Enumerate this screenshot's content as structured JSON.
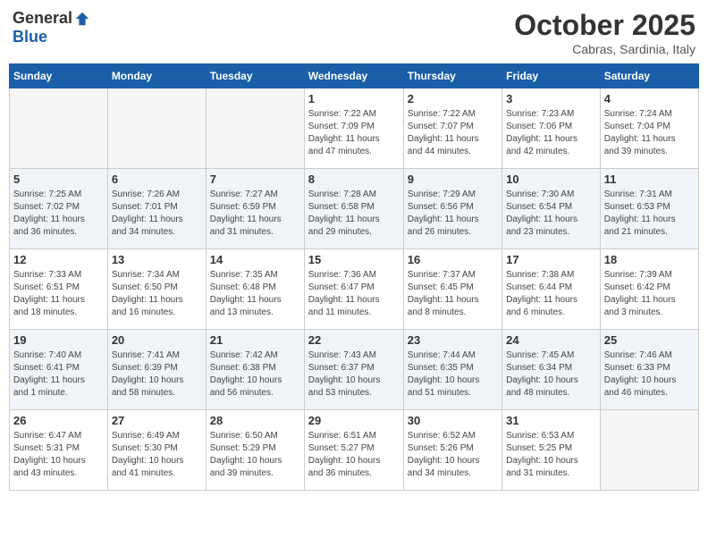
{
  "header": {
    "logo_general": "General",
    "logo_blue": "Blue",
    "month": "October 2025",
    "location": "Cabras, Sardinia, Italy"
  },
  "weekdays": [
    "Sunday",
    "Monday",
    "Tuesday",
    "Wednesday",
    "Thursday",
    "Friday",
    "Saturday"
  ],
  "weeks": [
    [
      {
        "day": "",
        "info": ""
      },
      {
        "day": "",
        "info": ""
      },
      {
        "day": "",
        "info": ""
      },
      {
        "day": "1",
        "info": "Sunrise: 7:22 AM\nSunset: 7:09 PM\nDaylight: 11 hours\nand 47 minutes."
      },
      {
        "day": "2",
        "info": "Sunrise: 7:22 AM\nSunset: 7:07 PM\nDaylight: 11 hours\nand 44 minutes."
      },
      {
        "day": "3",
        "info": "Sunrise: 7:23 AM\nSunset: 7:06 PM\nDaylight: 11 hours\nand 42 minutes."
      },
      {
        "day": "4",
        "info": "Sunrise: 7:24 AM\nSunset: 7:04 PM\nDaylight: 11 hours\nand 39 minutes."
      }
    ],
    [
      {
        "day": "5",
        "info": "Sunrise: 7:25 AM\nSunset: 7:02 PM\nDaylight: 11 hours\nand 36 minutes."
      },
      {
        "day": "6",
        "info": "Sunrise: 7:26 AM\nSunset: 7:01 PM\nDaylight: 11 hours\nand 34 minutes."
      },
      {
        "day": "7",
        "info": "Sunrise: 7:27 AM\nSunset: 6:59 PM\nDaylight: 11 hours\nand 31 minutes."
      },
      {
        "day": "8",
        "info": "Sunrise: 7:28 AM\nSunset: 6:58 PM\nDaylight: 11 hours\nand 29 minutes."
      },
      {
        "day": "9",
        "info": "Sunrise: 7:29 AM\nSunset: 6:56 PM\nDaylight: 11 hours\nand 26 minutes."
      },
      {
        "day": "10",
        "info": "Sunrise: 7:30 AM\nSunset: 6:54 PM\nDaylight: 11 hours\nand 23 minutes."
      },
      {
        "day": "11",
        "info": "Sunrise: 7:31 AM\nSunset: 6:53 PM\nDaylight: 11 hours\nand 21 minutes."
      }
    ],
    [
      {
        "day": "12",
        "info": "Sunrise: 7:33 AM\nSunset: 6:51 PM\nDaylight: 11 hours\nand 18 minutes."
      },
      {
        "day": "13",
        "info": "Sunrise: 7:34 AM\nSunset: 6:50 PM\nDaylight: 11 hours\nand 16 minutes."
      },
      {
        "day": "14",
        "info": "Sunrise: 7:35 AM\nSunset: 6:48 PM\nDaylight: 11 hours\nand 13 minutes."
      },
      {
        "day": "15",
        "info": "Sunrise: 7:36 AM\nSunset: 6:47 PM\nDaylight: 11 hours\nand 11 minutes."
      },
      {
        "day": "16",
        "info": "Sunrise: 7:37 AM\nSunset: 6:45 PM\nDaylight: 11 hours\nand 8 minutes."
      },
      {
        "day": "17",
        "info": "Sunrise: 7:38 AM\nSunset: 6:44 PM\nDaylight: 11 hours\nand 6 minutes."
      },
      {
        "day": "18",
        "info": "Sunrise: 7:39 AM\nSunset: 6:42 PM\nDaylight: 11 hours\nand 3 minutes."
      }
    ],
    [
      {
        "day": "19",
        "info": "Sunrise: 7:40 AM\nSunset: 6:41 PM\nDaylight: 11 hours\nand 1 minute."
      },
      {
        "day": "20",
        "info": "Sunrise: 7:41 AM\nSunset: 6:39 PM\nDaylight: 10 hours\nand 58 minutes."
      },
      {
        "day": "21",
        "info": "Sunrise: 7:42 AM\nSunset: 6:38 PM\nDaylight: 10 hours\nand 56 minutes."
      },
      {
        "day": "22",
        "info": "Sunrise: 7:43 AM\nSunset: 6:37 PM\nDaylight: 10 hours\nand 53 minutes."
      },
      {
        "day": "23",
        "info": "Sunrise: 7:44 AM\nSunset: 6:35 PM\nDaylight: 10 hours\nand 51 minutes."
      },
      {
        "day": "24",
        "info": "Sunrise: 7:45 AM\nSunset: 6:34 PM\nDaylight: 10 hours\nand 48 minutes."
      },
      {
        "day": "25",
        "info": "Sunrise: 7:46 AM\nSunset: 6:33 PM\nDaylight: 10 hours\nand 46 minutes."
      }
    ],
    [
      {
        "day": "26",
        "info": "Sunrise: 6:47 AM\nSunset: 5:31 PM\nDaylight: 10 hours\nand 43 minutes."
      },
      {
        "day": "27",
        "info": "Sunrise: 6:49 AM\nSunset: 5:30 PM\nDaylight: 10 hours\nand 41 minutes."
      },
      {
        "day": "28",
        "info": "Sunrise: 6:50 AM\nSunset: 5:29 PM\nDaylight: 10 hours\nand 39 minutes."
      },
      {
        "day": "29",
        "info": "Sunrise: 6:51 AM\nSunset: 5:27 PM\nDaylight: 10 hours\nand 36 minutes."
      },
      {
        "day": "30",
        "info": "Sunrise: 6:52 AM\nSunset: 5:26 PM\nDaylight: 10 hours\nand 34 minutes."
      },
      {
        "day": "31",
        "info": "Sunrise: 6:53 AM\nSunset: 5:25 PM\nDaylight: 10 hours\nand 31 minutes."
      },
      {
        "day": "",
        "info": ""
      }
    ]
  ]
}
